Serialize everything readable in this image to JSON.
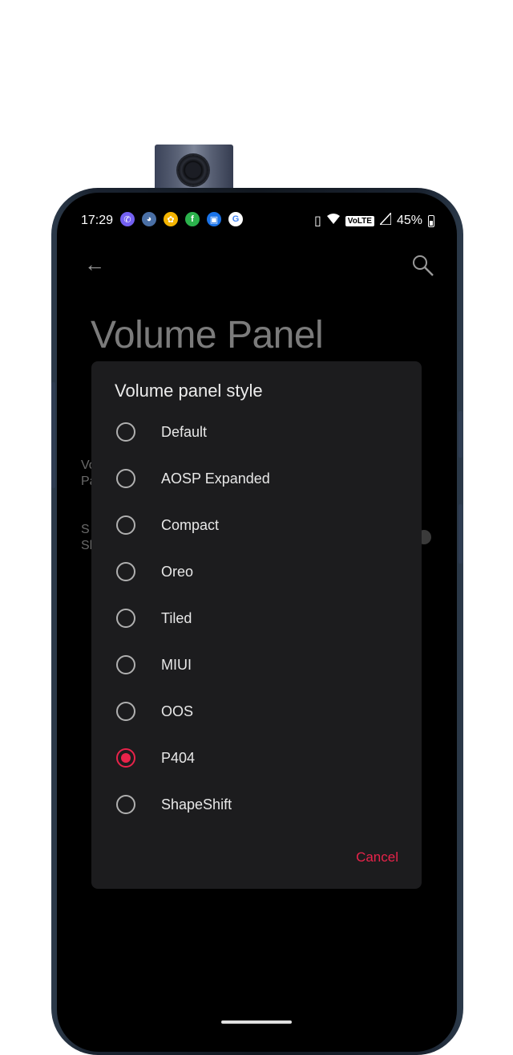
{
  "status_bar": {
    "time": "17:29",
    "notification_icons": [
      {
        "name": "viber-icon",
        "color": "#7360f2",
        "glyph": "✆"
      },
      {
        "name": "app-icon",
        "color": "#4a6fa5",
        "glyph": "◕"
      },
      {
        "name": "photos-icon",
        "color": "#f4b400",
        "glyph": "✿"
      },
      {
        "name": "feedly-icon",
        "color": "#2bb24c",
        "glyph": "f"
      },
      {
        "name": "gallery-icon",
        "color": "#1a73e8",
        "glyph": "▣"
      },
      {
        "name": "google-icon",
        "color": "#ffffff",
        "glyph": "G"
      }
    ],
    "volte": "VoLTE",
    "battery": "45%"
  },
  "page": {
    "title": "Volume Panel",
    "rows": [
      {
        "line1": "Vo",
        "line2": "Pa"
      },
      {
        "line1": "S",
        "line2": "Sh"
      }
    ]
  },
  "dialog": {
    "title": "Volume panel style",
    "options": [
      {
        "label": "Default",
        "selected": false
      },
      {
        "label": "AOSP Expanded",
        "selected": false
      },
      {
        "label": "Compact",
        "selected": false
      },
      {
        "label": "Oreo",
        "selected": false
      },
      {
        "label": "Tiled",
        "selected": false
      },
      {
        "label": "MIUI",
        "selected": false
      },
      {
        "label": "OOS",
        "selected": false
      },
      {
        "label": "P404",
        "selected": true
      },
      {
        "label": "ShapeShift",
        "selected": false
      }
    ],
    "cancel_label": "Cancel"
  },
  "colors": {
    "accent": "#e8234a",
    "dialog_bg": "#1c1c1e",
    "screen_bg": "#000000"
  }
}
